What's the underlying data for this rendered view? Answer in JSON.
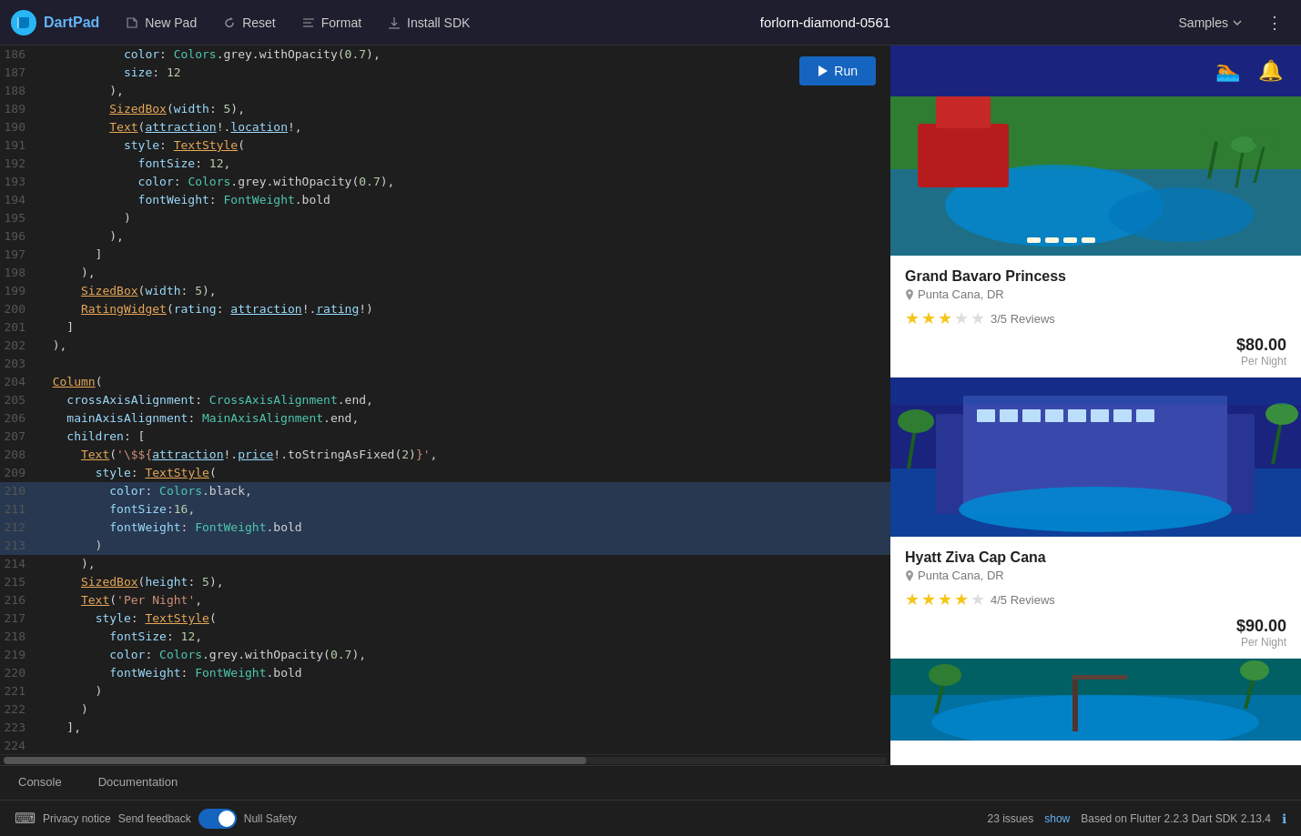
{
  "toolbar": {
    "logo_text": "DartPad",
    "new_pad_label": "New Pad",
    "reset_label": "Reset",
    "format_label": "Format",
    "install_sdk_label": "Install SDK",
    "title": "forlorn-diamond-0561",
    "samples_label": "Samples"
  },
  "run_button": {
    "label": "Run"
  },
  "code": {
    "lines": [
      {
        "num": "186",
        "tokens": [
          {
            "text": "            color: Colors.grey.withOpacity(0.7),",
            "type": "mixed"
          }
        ]
      },
      {
        "num": "187",
        "tokens": [
          {
            "text": "            size: 12",
            "type": "mixed"
          }
        ]
      },
      {
        "num": "188",
        "tokens": [
          {
            "text": "          ),",
            "type": "punc"
          }
        ]
      },
      {
        "num": "189",
        "tokens": [
          {
            "text": "          SizedBox(width: 5),",
            "type": "fn_call"
          }
        ]
      },
      {
        "num": "190",
        "tokens": [
          {
            "text": "          Text(attraction!.location!,",
            "type": "fn_call_underline"
          }
        ]
      },
      {
        "num": "191",
        "tokens": [
          {
            "text": "            style: TextStyle(",
            "type": "mixed"
          }
        ]
      },
      {
        "num": "192",
        "tokens": [
          {
            "text": "              fontSize: 12,",
            "type": "mixed"
          }
        ]
      },
      {
        "num": "193",
        "tokens": [
          {
            "text": "              color: Colors.grey.withOpacity(0.7),",
            "type": "mixed"
          }
        ]
      },
      {
        "num": "194",
        "tokens": [
          {
            "text": "              fontWeight: FontWeight.bold",
            "type": "mixed"
          }
        ]
      },
      {
        "num": "195",
        "tokens": [
          {
            "text": "            )",
            "type": "punc"
          }
        ]
      },
      {
        "num": "196",
        "tokens": [
          {
            "text": "          ),",
            "type": "punc"
          }
        ]
      },
      {
        "num": "197",
        "tokens": [
          {
            "text": "        ]",
            "type": "punc"
          }
        ]
      },
      {
        "num": "198",
        "tokens": [
          {
            "text": "      ),",
            "type": "punc"
          }
        ]
      },
      {
        "num": "199",
        "tokens": [
          {
            "text": "      SizedBox(width: 5),",
            "type": "fn_call"
          }
        ]
      },
      {
        "num": "200",
        "tokens": [
          {
            "text": "      RatingWidget(rating: attraction!.rating!)",
            "type": "fn_call_underline"
          }
        ]
      },
      {
        "num": "201",
        "tokens": [
          {
            "text": "    ]",
            "type": "punc"
          }
        ]
      },
      {
        "num": "202",
        "tokens": [
          {
            "text": "  ),",
            "type": "punc"
          }
        ]
      },
      {
        "num": "203",
        "tokens": [
          {
            "text": "",
            "type": "empty"
          }
        ]
      },
      {
        "num": "204",
        "tokens": [
          {
            "text": "  Column(",
            "type": "fn_call"
          }
        ]
      },
      {
        "num": "205",
        "tokens": [
          {
            "text": "    crossAxisAlignment: CrossAxisAlignment.end,",
            "type": "mixed"
          }
        ]
      },
      {
        "num": "206",
        "tokens": [
          {
            "text": "    mainAxisAlignment: MainAxisAlignment.end,",
            "type": "mixed"
          }
        ]
      },
      {
        "num": "207",
        "tokens": [
          {
            "text": "    children: [",
            "type": "mixed"
          }
        ]
      },
      {
        "num": "208",
        "tokens": [
          {
            "text": "      Text('\\$$\\{attraction!.price!.toStringAsFixed(2)\\}',",
            "type": "mixed_str"
          }
        ]
      },
      {
        "num": "209",
        "tokens": [
          {
            "text": "        style: TextStyle(",
            "type": "mixed"
          }
        ]
      },
      {
        "num": "210",
        "tokens": [
          {
            "text": "          color: Colors.black,",
            "type": "mixed",
            "selected": true
          }
        ]
      },
      {
        "num": "211",
        "tokens": [
          {
            "text": "          fontSize:16,",
            "type": "mixed",
            "selected": true
          }
        ]
      },
      {
        "num": "212",
        "tokens": [
          {
            "text": "          fontWeight: FontWeight.bold",
            "type": "mixed",
            "selected": true
          }
        ]
      },
      {
        "num": "213",
        "tokens": [
          {
            "text": "        )",
            "type": "punc",
            "selected": true
          }
        ]
      },
      {
        "num": "214",
        "tokens": [
          {
            "text": "      ),",
            "type": "punc"
          }
        ]
      },
      {
        "num": "215",
        "tokens": [
          {
            "text": "      SizedBox(height: 5),",
            "type": "fn_call"
          }
        ]
      },
      {
        "num": "216",
        "tokens": [
          {
            "text": "      Text('Per Night',",
            "type": "mixed_str"
          }
        ]
      },
      {
        "num": "217",
        "tokens": [
          {
            "text": "        style: TextStyle(",
            "type": "mixed"
          }
        ]
      },
      {
        "num": "218",
        "tokens": [
          {
            "text": "          fontSize: 12,",
            "type": "mixed"
          }
        ]
      },
      {
        "num": "219",
        "tokens": [
          {
            "text": "          color: Colors.grey.withOpacity(0.7),",
            "type": "mixed"
          }
        ]
      },
      {
        "num": "220",
        "tokens": [
          {
            "text": "          fontWeight: FontWeight.bold",
            "type": "mixed"
          }
        ]
      },
      {
        "num": "221",
        "tokens": [
          {
            "text": "        )",
            "type": "punc"
          }
        ]
      },
      {
        "num": "222",
        "tokens": [
          {
            "text": "      )",
            "type": "punc"
          }
        ]
      },
      {
        "num": "223",
        "tokens": [
          {
            "text": "    ],",
            "type": "punc"
          }
        ]
      },
      {
        "num": "224",
        "tokens": [
          {
            "text": "",
            "type": "empty"
          }
        ]
      }
    ]
  },
  "preview": {
    "hotels": [
      {
        "name": "Grand Bavaro Princess",
        "location": "Punta Cana, DR",
        "stars": 3,
        "max_stars": 5,
        "reviews": "3/5 Reviews",
        "price": "$80.00",
        "per_night": "Per Night",
        "img_colors": [
          "#2e7d32",
          "#1565c0",
          "#558b2f"
        ]
      },
      {
        "name": "Hyatt Ziva Cap Cana",
        "location": "Punta Cana, DR",
        "stars": 4,
        "max_stars": 5,
        "reviews": "4/5 Reviews",
        "price": "$90.00",
        "per_night": "Per Night",
        "img_colors": [
          "#1a237e",
          "#0d47a1",
          "#1b5e20"
        ]
      }
    ]
  },
  "bottom_tabs": [
    {
      "label": "Console",
      "active": false
    },
    {
      "label": "Documentation",
      "active": false
    }
  ],
  "status_bar": {
    "privacy_notice": "Privacy notice",
    "send_feedback": "Send feedback",
    "null_safety": "Null Safety",
    "issues_count": "23 issues",
    "issues_show": "show",
    "flutter_info": "Based on Flutter 2.2.3 Dart SDK 2.13.4"
  }
}
